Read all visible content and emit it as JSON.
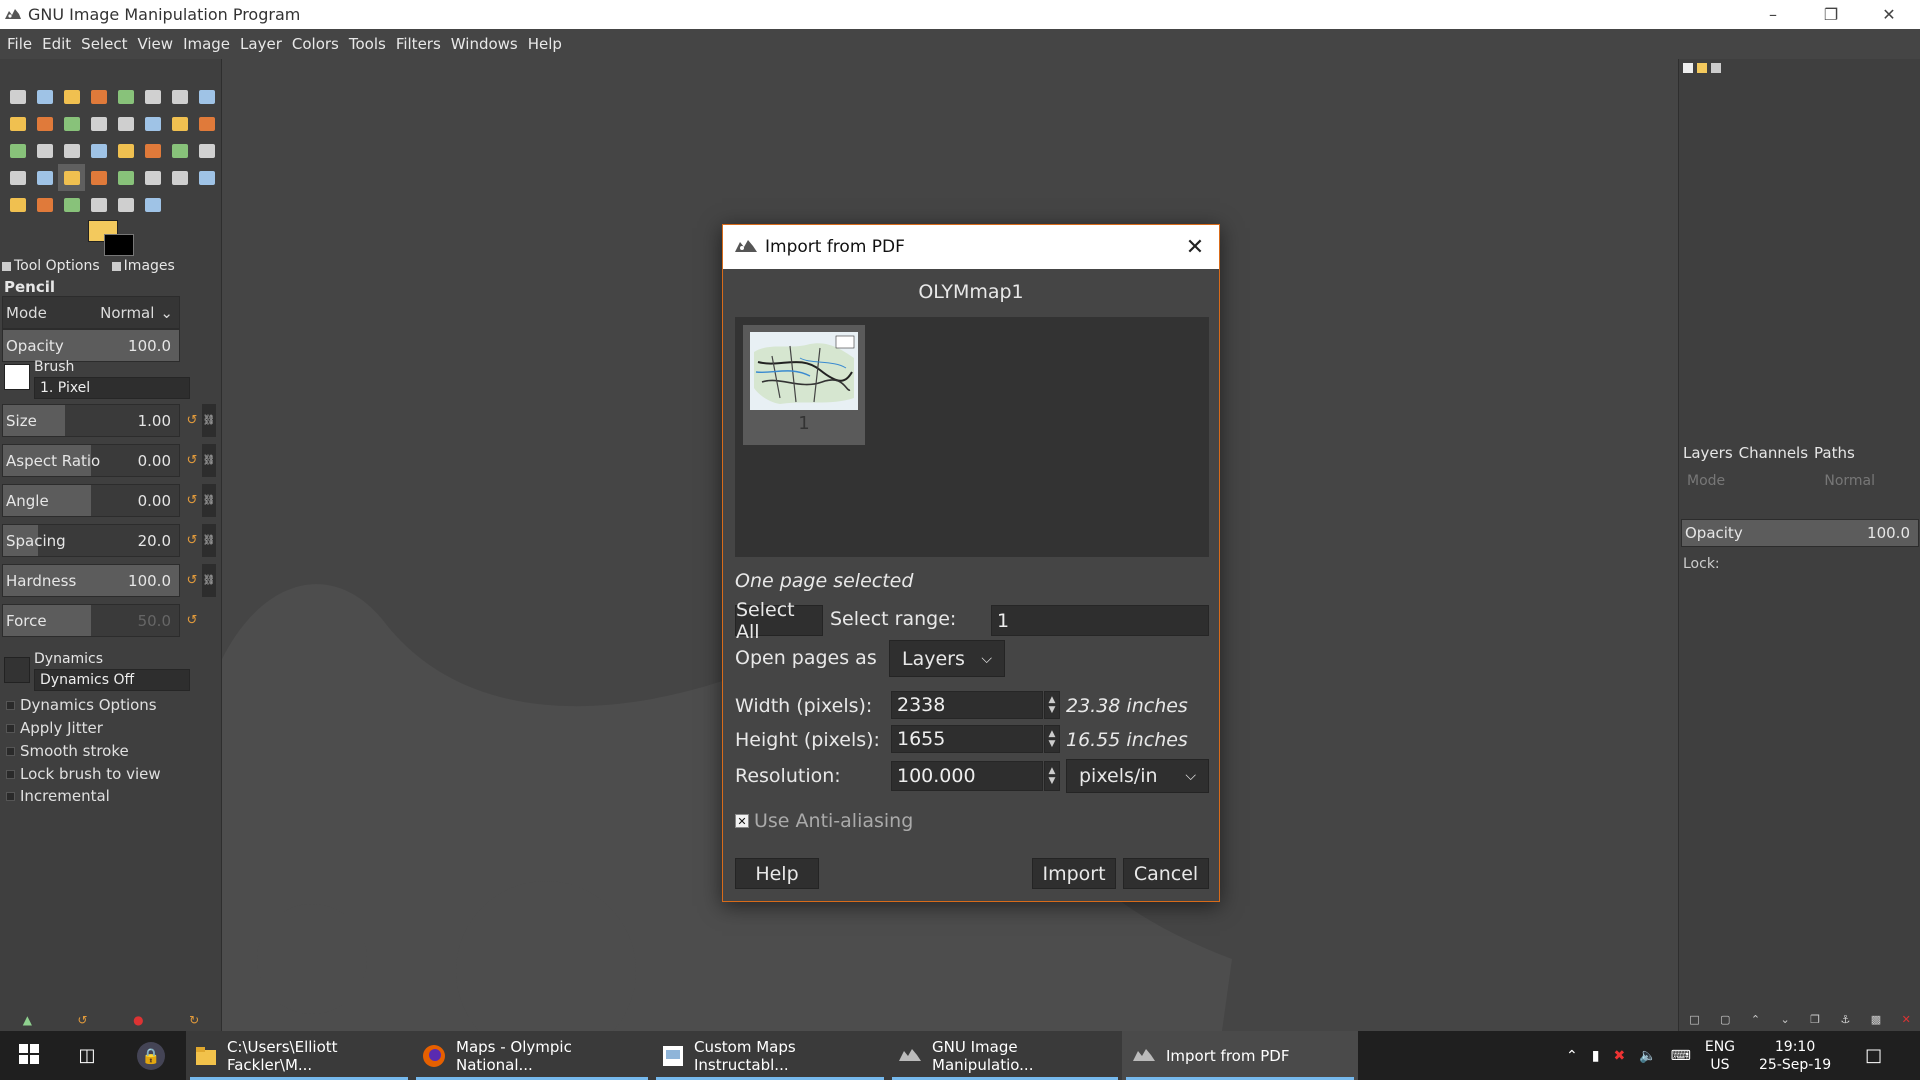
{
  "window": {
    "title": "GNU Image Manipulation Program",
    "minimize_glyph": "–",
    "restore_glyph": "❐",
    "close_glyph": "✕"
  },
  "menu": [
    "File",
    "Edit",
    "Select",
    "View",
    "Image",
    "Layer",
    "Colors",
    "Tools",
    "Filters",
    "Windows",
    "Help"
  ],
  "colors": {
    "foreground": "#f3c95d",
    "background": "#000000",
    "dialog_border": "#d86b1a",
    "accent": "#e39b3b"
  },
  "tool_icons": [
    "rect-select-icon",
    "ellipse-select-icon",
    "free-select-icon",
    "fuzzy-select-icon",
    "select-by-color-icon",
    "scissors-select-icon",
    "foreground-select-icon",
    "align-icon",
    "paths-icon",
    "zoom-icon",
    "measure-icon",
    "move-icon",
    "alignment-icon",
    "crop-icon",
    "transform-icon",
    "flip-icon",
    "warp-icon",
    "perspective-icon",
    "unified-transform-icon",
    "rotate-icon",
    "scale-icon",
    "cage-icon",
    "shear-icon",
    "text-icon",
    "bucket-fill-icon",
    "gradient-icon",
    "pencil-icon",
    "paintbrush-icon",
    "eraser-icon",
    "airbrush-icon",
    "ink-icon",
    "color-picker-icon",
    "clone-icon",
    "heal-icon",
    "perspective-clone-icon",
    "blur-icon",
    "smudge-icon",
    "dodge-icon"
  ],
  "tool_options": {
    "tab_tool_options": "Tool Options",
    "tab_images": "Images",
    "tool_name": "Pencil",
    "mode_label": "Mode",
    "mode_value": "Normal",
    "opacity_label": "Opacity",
    "opacity_value": "100.0",
    "brush_label": "Brush",
    "brush_value": "1. Pixel",
    "sliders": [
      {
        "label": "Size",
        "value": "1.00",
        "fill": 0.35
      },
      {
        "label": "Aspect Ratio",
        "value": "0.00",
        "fill": 0.5
      },
      {
        "label": "Angle",
        "value": "0.00",
        "fill": 0.5
      },
      {
        "label": "Spacing",
        "value": "20.0",
        "fill": 0.2
      },
      {
        "label": "Hardness",
        "value": "100.0",
        "fill": 1.0
      },
      {
        "label": "Force",
        "value": "50.0",
        "fill": 0.5
      }
    ],
    "dynamics_label": "Dynamics",
    "dynamics_value": "Dynamics Off",
    "checks": [
      "Dynamics Options",
      "Apply Jitter",
      "Smooth stroke",
      "Lock brush to view",
      "Incremental"
    ]
  },
  "right_panel": {
    "tab_layers": "Layers",
    "tab_channels": "Channels",
    "tab_paths": "Paths",
    "mode_label": "Mode",
    "mode_value": "Normal",
    "opacity_label": "Opacity",
    "opacity_value": "100.0",
    "lock_label": "Lock:"
  },
  "dialog": {
    "title": "Import from PDF",
    "document_name": "OLYMmap1",
    "thumb_page_number": "1",
    "selection_status": "One page selected",
    "select_all_label": "Select All",
    "select_range_label": "Select range:",
    "select_range_value": "1",
    "open_pages_label": "Open pages as",
    "open_pages_value": "Layers",
    "width_label": "Width (pixels):",
    "width_value": "2338",
    "width_inches": "23.38 inches",
    "height_label": "Height (pixels):",
    "height_value": "1655",
    "height_inches": "16.55 inches",
    "resolution_label": "Resolution:",
    "resolution_value": "100.000",
    "resolution_unit": "pixels/in",
    "antialias_label": "Use Anti-aliasing",
    "help_label": "Help",
    "import_label": "Import",
    "cancel_label": "Cancel"
  },
  "taskbar": {
    "items": [
      {
        "label": "C:\\Users\\Elliott Fackler\\M...",
        "icon": "folder-icon"
      },
      {
        "label": "Maps - Olympic National...",
        "icon": "firefox-icon"
      },
      {
        "label": "Custom Maps Instructabl...",
        "icon": "document-icon"
      },
      {
        "label": "GNU Image Manipulatio...",
        "icon": "gimp-icon"
      },
      {
        "label": "Import from PDF",
        "icon": "gimp-icon"
      }
    ],
    "lang_top": "ENG",
    "lang_bottom": "US",
    "time": "19:10",
    "date": "25-Sep-19"
  }
}
